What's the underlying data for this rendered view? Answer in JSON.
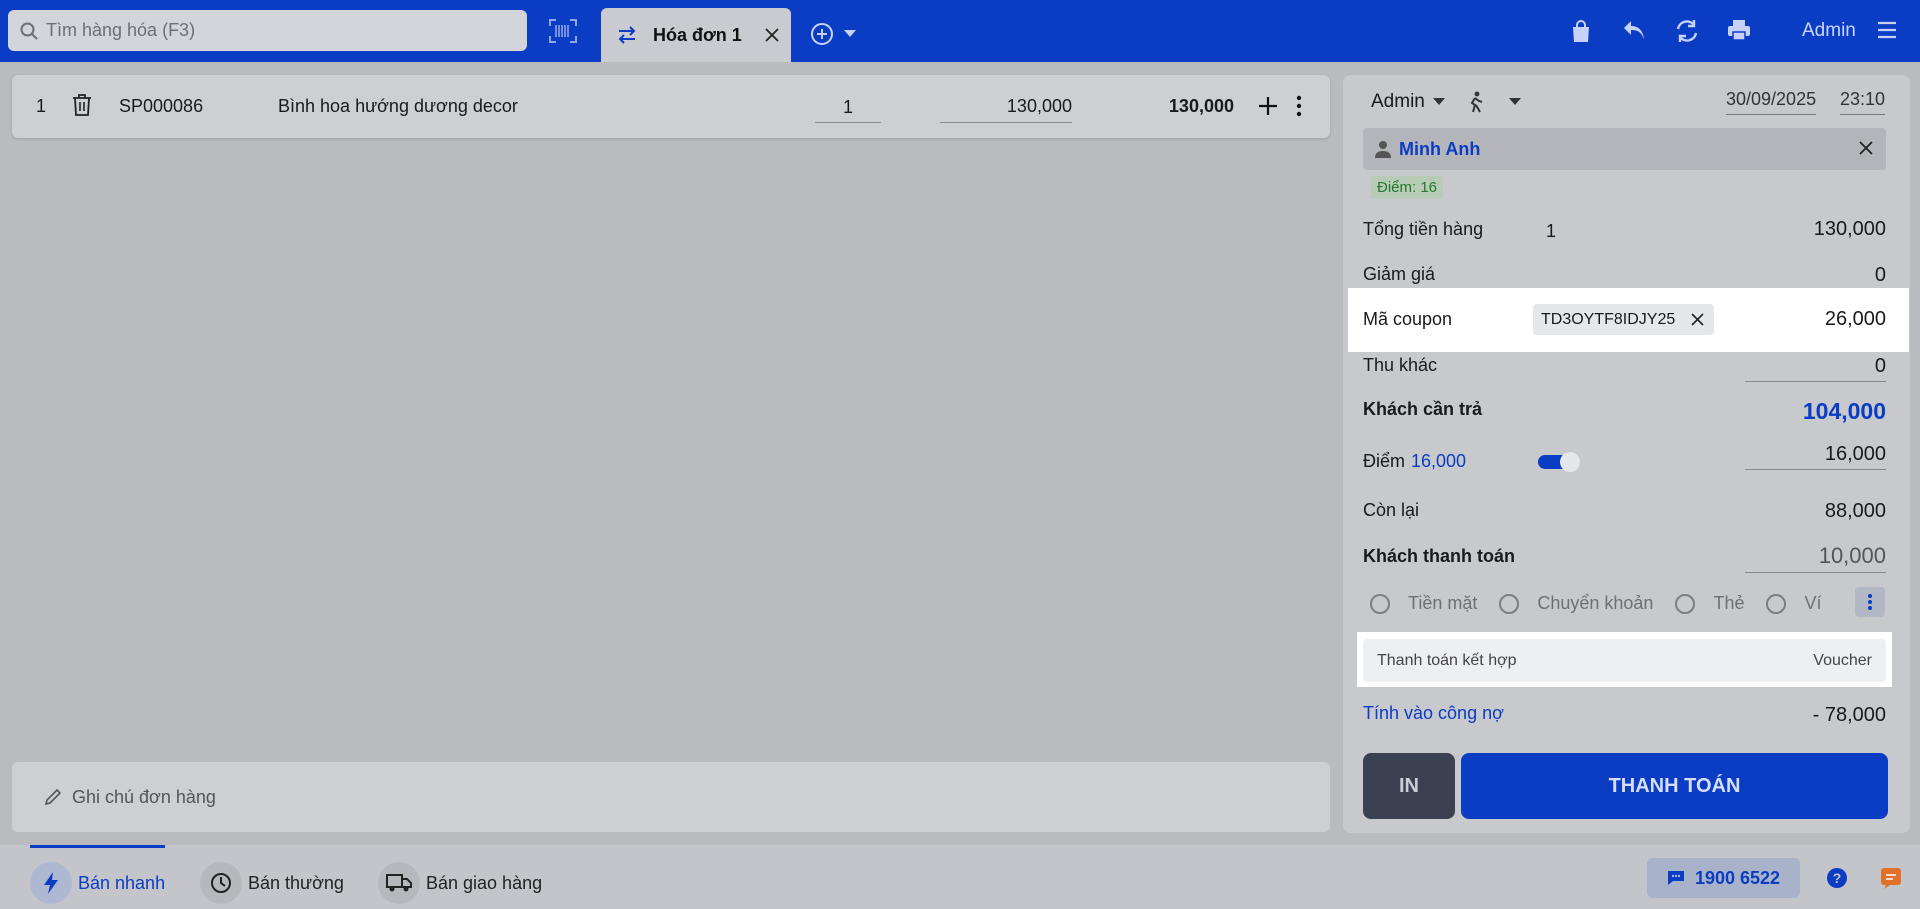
{
  "colors": {
    "brand": "#0b3cc4",
    "overlay": "#babbbf",
    "points_green": "#237a2a"
  },
  "search": {
    "placeholder": "Tìm hàng hóa (F3)"
  },
  "tab": {
    "label": "Hóa đơn 1"
  },
  "header": {
    "user": "Admin"
  },
  "icons": [
    "search-icon",
    "barcode-icon",
    "swap-icon",
    "close-icon",
    "add-circle-icon",
    "chevron-down-icon",
    "shopping-bag-icon",
    "undo-icon",
    "refresh-icon",
    "print-icon",
    "menu-icon",
    "trash-icon",
    "plus-icon",
    "more-vertical-icon",
    "pencil-icon",
    "person-icon",
    "walk-icon",
    "bolt-icon",
    "clock-icon",
    "truck-icon",
    "chat-icon",
    "help-icon"
  ],
  "order": {
    "items": [
      {
        "index": "1",
        "code": "SP000086",
        "name": "Bình hoa hướng dương decor",
        "qty": "1",
        "price": "130,000",
        "total": "130,000"
      }
    ],
    "note_placeholder": "Ghi chú đơn hàng"
  },
  "checkout": {
    "seller": "Admin",
    "date": "30/09/2025",
    "time": "23:10",
    "customer": "Minh Anh",
    "points_badge": "Điểm: 16",
    "total_label": "Tổng tiền hàng",
    "total_qty": "1",
    "total_value": "130,000",
    "discount_label": "Giảm giá",
    "discount_value": "0",
    "coupon_label": "Mã coupon",
    "coupon_code": "TD3OYTF8IDJY25",
    "coupon_value": "26,000",
    "other_label": "Thu khác",
    "other_value": "0",
    "payable_label": "Khách cần trả",
    "payable_value": "104,000",
    "points_label": "Điểm",
    "points_available": "16,000",
    "points_on": true,
    "points_value": "16,000",
    "remaining_label": "Còn lại",
    "remaining_value": "88,000",
    "paid_label": "Khách thanh toán",
    "paid_value": "10,000",
    "methods": [
      "Tiền mặt",
      "Chuyển khoản",
      "Thẻ",
      "Ví"
    ],
    "combo_label": "Thanh toán kết hợp",
    "combo_value": "Voucher",
    "debt_label": "Tính vào công nợ",
    "debt_value": "- 78,000",
    "print_button": "IN",
    "pay_button": "THANH TOÁN"
  },
  "bottom": {
    "modes": [
      "Bán nhanh",
      "Bán thường",
      "Bán giao hàng"
    ],
    "hotline": "1900 6522"
  }
}
